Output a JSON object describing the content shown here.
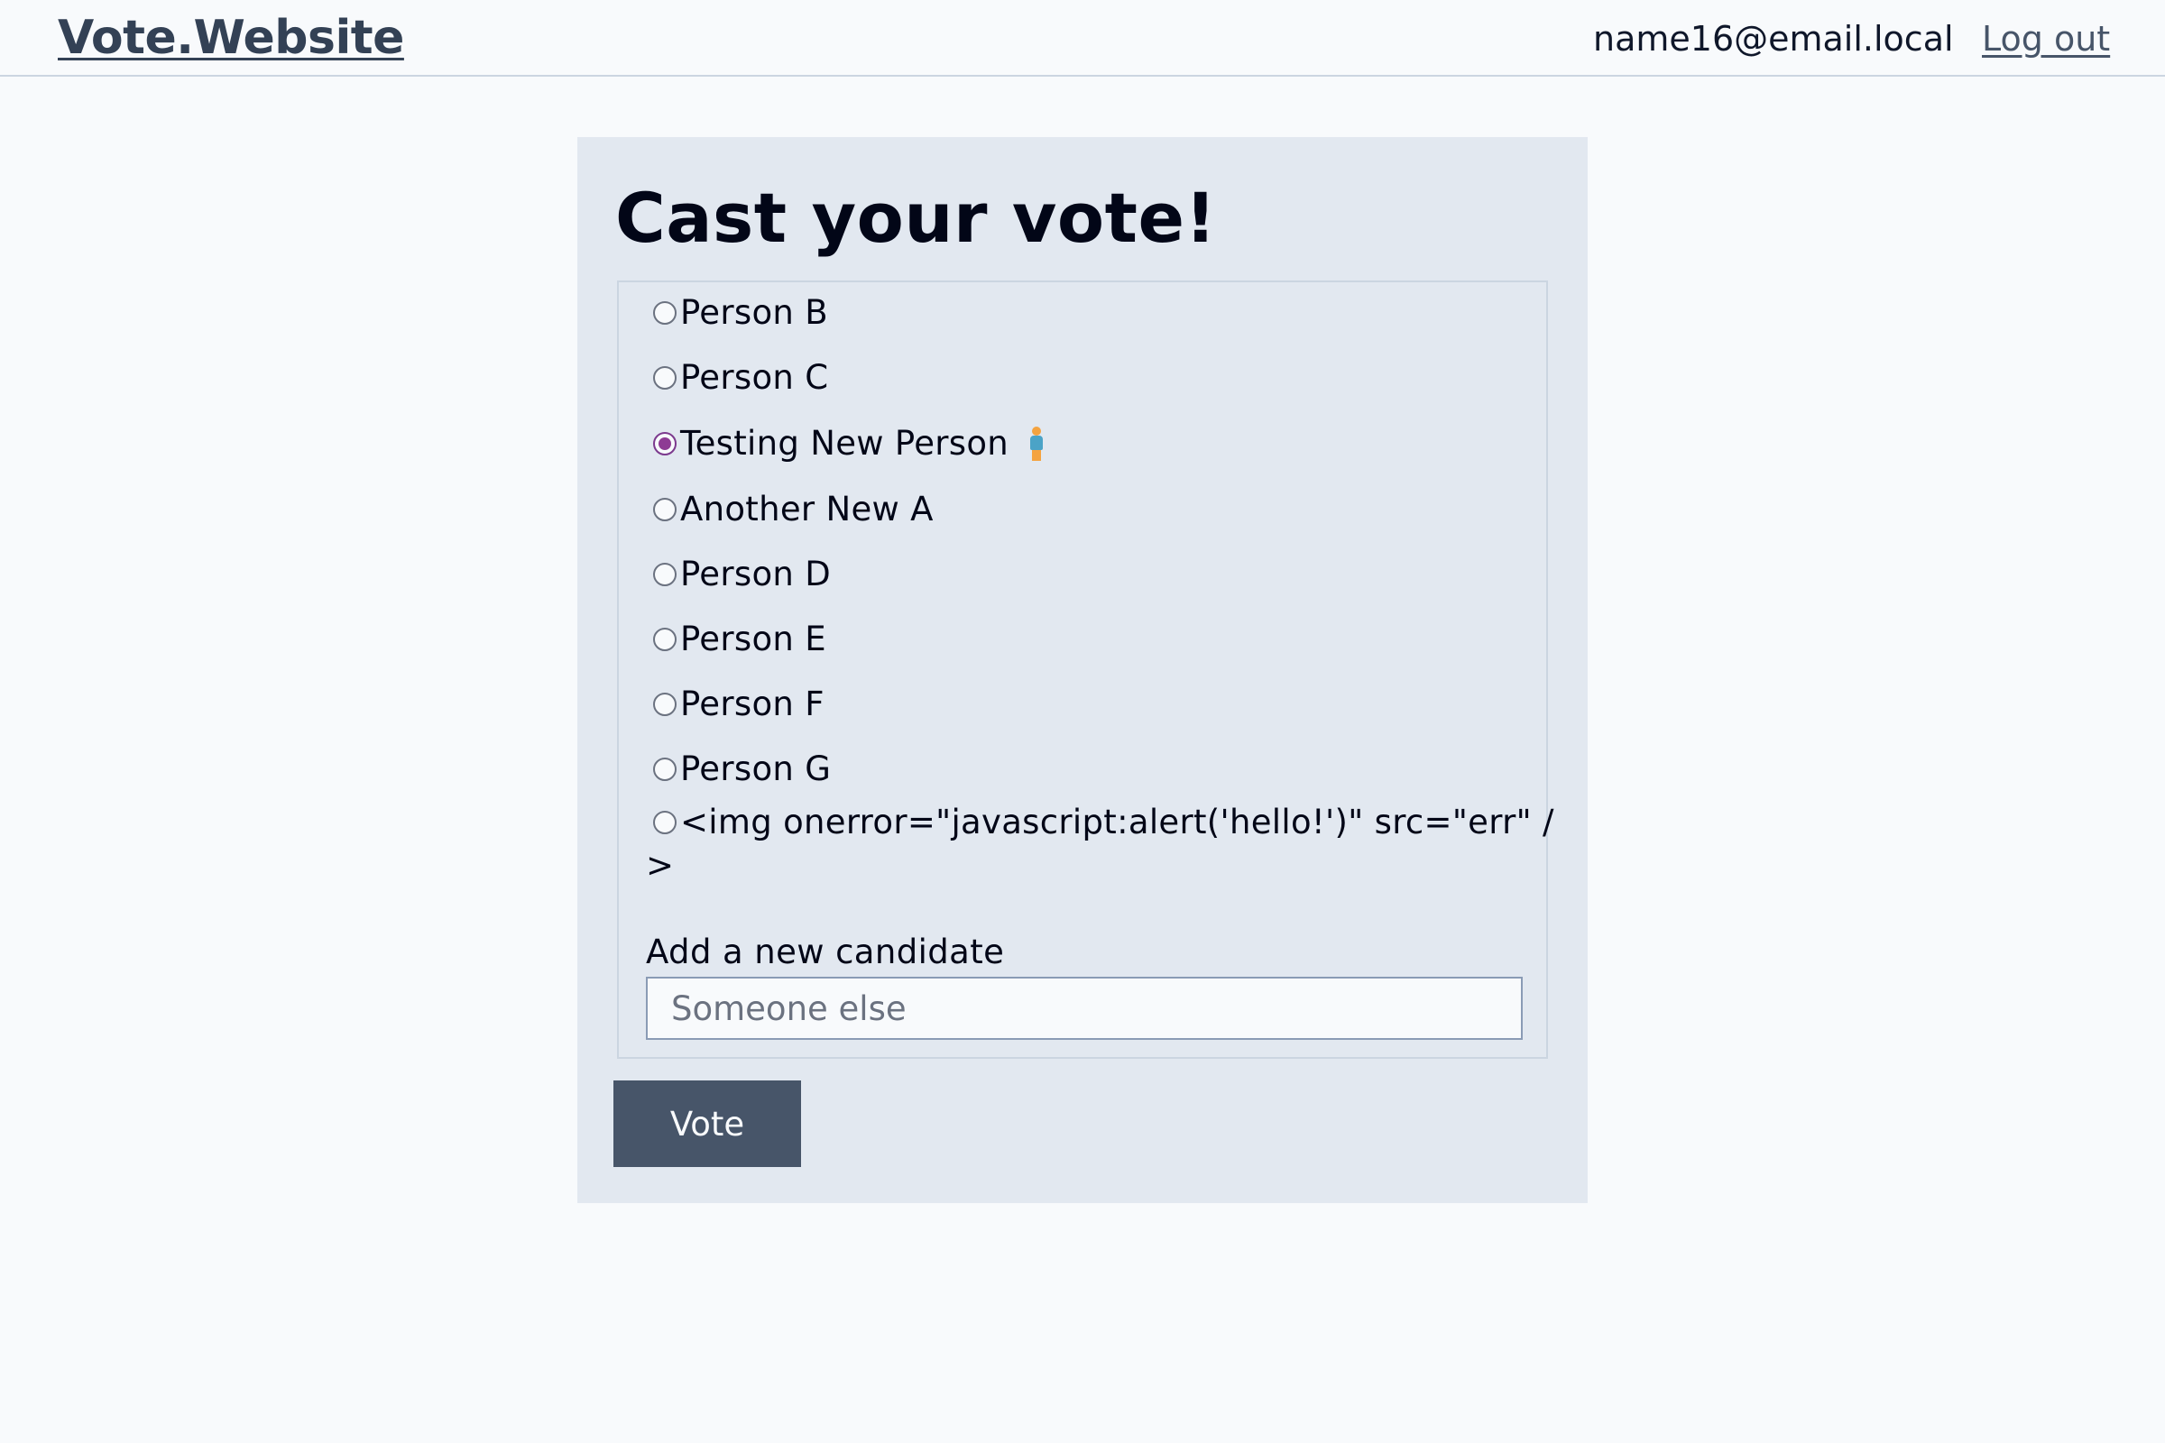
{
  "header": {
    "brand": "Vote.Website",
    "user_email": "name16@email.local",
    "logout_label": "Log out"
  },
  "form": {
    "title": "Cast your vote!",
    "options": [
      {
        "label": "Person B",
        "checked": false
      },
      {
        "label": "Person C",
        "checked": false
      },
      {
        "label": "Testing New Person",
        "checked": true,
        "emoji": "person-emoji"
      },
      {
        "label": "Another New A",
        "checked": false
      },
      {
        "label": "Person D",
        "checked": false
      },
      {
        "label": "Person E",
        "checked": false
      },
      {
        "label": "Person F",
        "checked": false
      },
      {
        "label": "Person G",
        "checked": false
      },
      {
        "label": "<img onerror=\"javascript:alert('hello!')\" src=\"err\" /",
        "label_wrap": ">",
        "checked": false
      }
    ],
    "new_candidate_label": "Add a new candidate",
    "new_candidate_placeholder": "Someone else",
    "new_candidate_value": "",
    "submit_label": "Vote"
  },
  "colors": {
    "page_bg": "#f8fafc",
    "panel_bg": "#e2e8f0",
    "button_bg": "#475569",
    "radio_checked": "#8e3b94",
    "brand_text": "#334155"
  }
}
